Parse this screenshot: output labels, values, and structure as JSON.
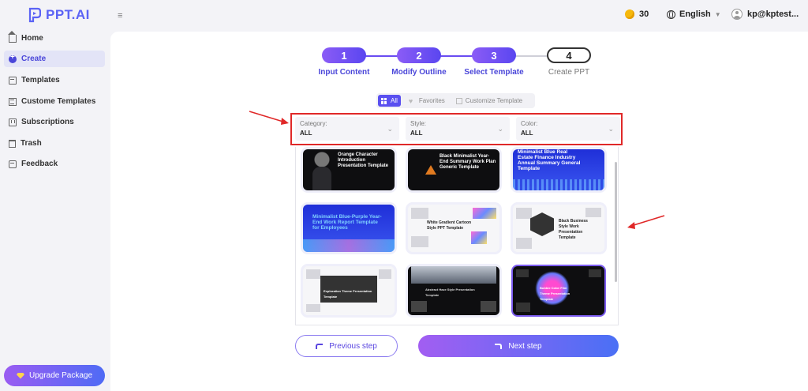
{
  "app": {
    "name": "PPT.AI"
  },
  "topbar": {
    "coins": "30",
    "language": "English",
    "user": "kp@kptest..."
  },
  "sidebar": {
    "items": [
      {
        "label": "Home",
        "icon": "home-icon",
        "active": false
      },
      {
        "label": "Create",
        "icon": "create-icon",
        "active": true
      },
      {
        "label": "Templates",
        "icon": "templates-icon",
        "active": false
      },
      {
        "label": "Custome Templates",
        "icon": "custom-templates-icon",
        "active": false
      },
      {
        "label": "Subscriptions",
        "icon": "subscriptions-icon",
        "active": false
      },
      {
        "label": "Trash",
        "icon": "trash-icon",
        "active": false
      },
      {
        "label": "Feedback",
        "icon": "feedback-icon",
        "active": false
      }
    ],
    "upgrade_label": "Upgrade Package"
  },
  "steps": [
    {
      "number": "1",
      "label": "Input Content",
      "state": "done"
    },
    {
      "number": "2",
      "label": "Modify Outline",
      "state": "done"
    },
    {
      "number": "3",
      "label": "Select Template",
      "state": "current"
    },
    {
      "number": "4",
      "label": "Create PPT",
      "state": "pending"
    }
  ],
  "tabs": {
    "all": "All",
    "favorites": "Favorites",
    "customize": "Customize Template"
  },
  "filters": [
    {
      "label": "Category:",
      "value": "ALL"
    },
    {
      "label": "Style:",
      "value": "ALL"
    },
    {
      "label": "Color:",
      "value": "ALL"
    }
  ],
  "templates": [
    {
      "title": "Orange Character Introduction Presentation Template"
    },
    {
      "title": "Black Minimalist Year-End Summary Work Plan Generic Template"
    },
    {
      "title": "Minimalist Blue Real Estate Finance Industry Annual Summary General Template"
    },
    {
      "title": "Minimalist Blue-Purple Year-End Work Report Template for Employees"
    },
    {
      "title": "White Gradient Cartoon Style PPT Template"
    },
    {
      "title": "Black Business Style Work Presentation Template"
    },
    {
      "title": "Exploration Theme Presentation Template"
    },
    {
      "title": "Abstract Haze Style Presentation Template"
    },
    {
      "title": "Bubble Color Film Theme Presentation Template"
    }
  ],
  "buttons": {
    "previous": "Previous step",
    "next": "Next step"
  },
  "colors": {
    "accent": "#5a46f0",
    "annotation": "#e02828"
  }
}
